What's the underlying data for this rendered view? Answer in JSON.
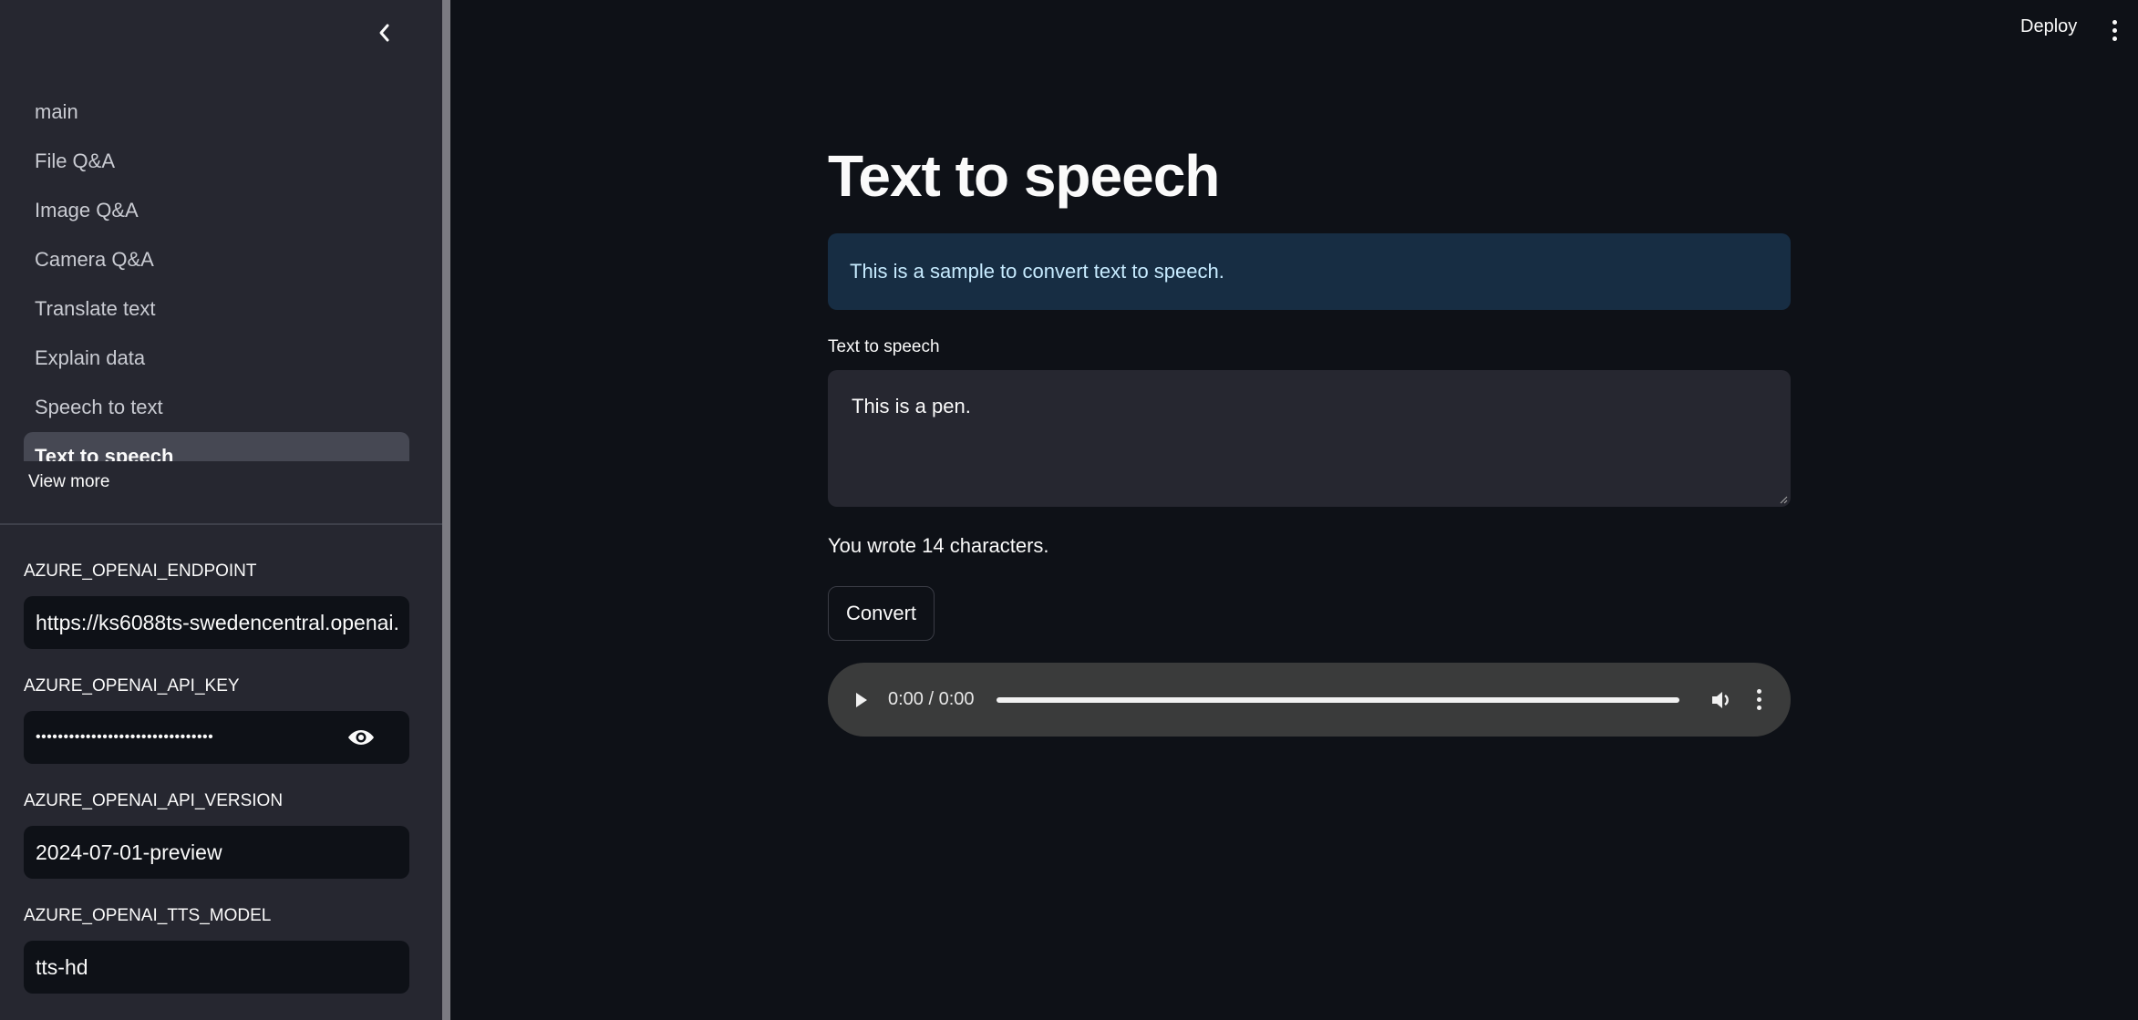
{
  "header": {
    "deploy_label": "Deploy",
    "menu_icon": "more-vertical-icon"
  },
  "sidebar": {
    "collapse_icon": "chevron-left-icon",
    "nav_items": [
      {
        "label": "main",
        "active": false
      },
      {
        "label": "File Q&A",
        "active": false
      },
      {
        "label": "Image Q&A",
        "active": false
      },
      {
        "label": "Camera Q&A",
        "active": false
      },
      {
        "label": "Translate text",
        "active": false
      },
      {
        "label": "Explain data",
        "active": false
      },
      {
        "label": "Speech to text",
        "active": false
      },
      {
        "label": "Text to speech",
        "active": true
      }
    ],
    "view_more_label": "View more",
    "fields": [
      {
        "label": "AZURE_OPENAI_ENDPOINT",
        "value": "https://ks6088ts-swedencentral.openai.",
        "type": "text"
      },
      {
        "label": "AZURE_OPENAI_API_KEY",
        "value": "••••••••••••••••••••••••••••••••",
        "type": "password",
        "toggle_icon": "eye-icon"
      },
      {
        "label": "AZURE_OPENAI_API_VERSION",
        "value": "2024-07-01-preview",
        "type": "text"
      },
      {
        "label": "AZURE_OPENAI_TTS_MODEL",
        "value": "tts-hd",
        "type": "text"
      }
    ]
  },
  "main": {
    "title": "Text to speech",
    "info_message": "This is a sample to convert text to speech.",
    "textarea_label": "Text to speech",
    "textarea_value": "This is a pen.",
    "char_count_text": "You wrote 14 characters.",
    "convert_label": "Convert",
    "audio": {
      "time_text": "0:00 / 0:00",
      "progress": 0
    }
  },
  "colors": {
    "background": "#0e1117",
    "sidebar": "#262730",
    "info_bg": "#172d43",
    "info_text": "#c7ebff",
    "active_nav": "#464853"
  }
}
